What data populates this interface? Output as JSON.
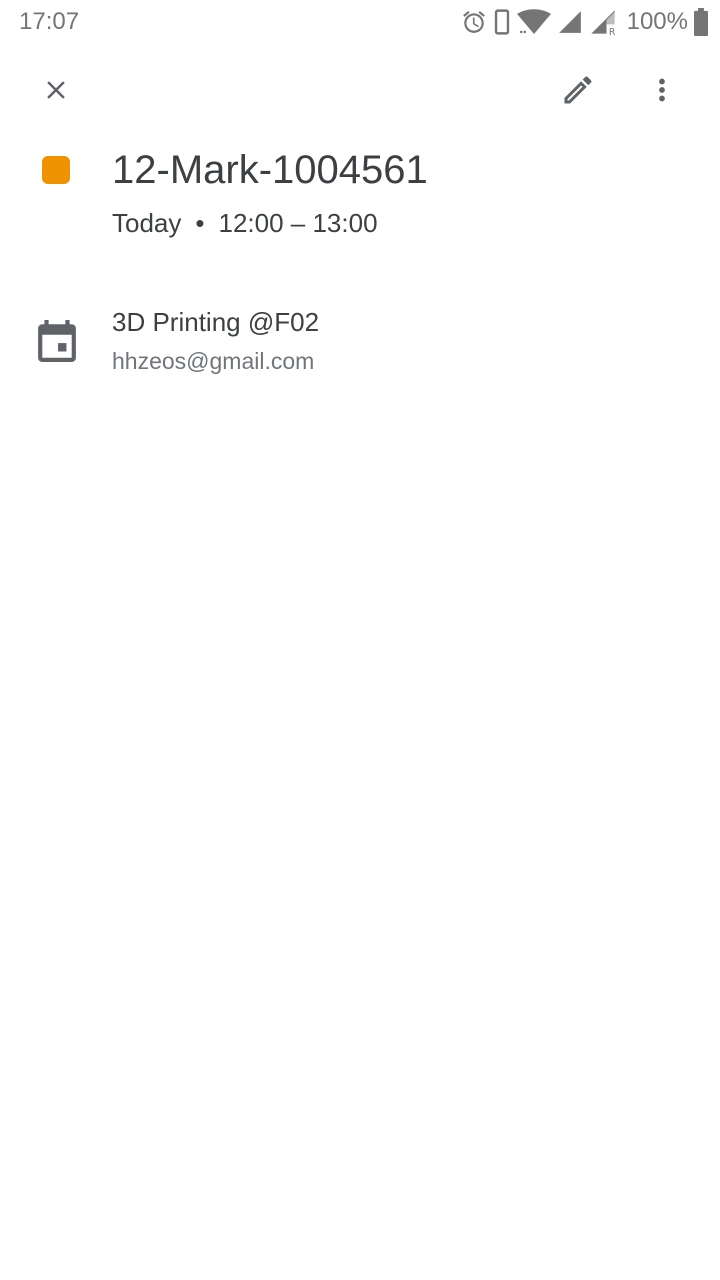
{
  "status_bar": {
    "time": "17:07",
    "battery_percent": "100%",
    "icons": [
      "alarm-icon",
      "phone-icon",
      "wifi-icon",
      "signal-icon",
      "signal-roaming-icon",
      "battery-icon"
    ]
  },
  "toolbar": {
    "close_icon": "close-icon",
    "edit_icon": "pencil-icon",
    "more_icon": "more-vert-icon"
  },
  "event": {
    "color": "#F09300",
    "title": "12-Mark-1004561",
    "day": "Today",
    "separator": "•",
    "time_range": "12:00 – 13:00"
  },
  "calendar": {
    "icon": "calendar-icon",
    "name": "3D Printing @F02",
    "account": "hhzeos@gmail.com"
  },
  "colors": {
    "icon": "#5f6368",
    "text_primary": "#3c4043",
    "text_secondary": "#70757a",
    "status": "#757575"
  }
}
